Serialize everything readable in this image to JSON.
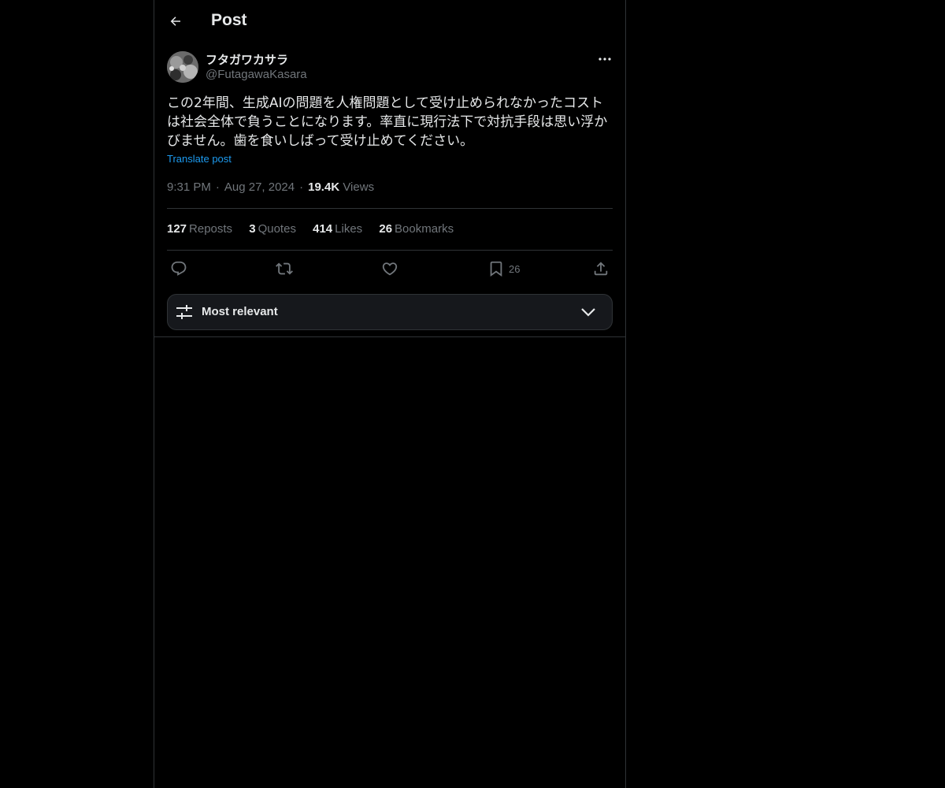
{
  "header": {
    "title": "Post",
    "back_icon": "arrow-left-icon"
  },
  "author": {
    "display_name": "フタガワカサラ",
    "handle": "@FutagawaKasara"
  },
  "post": {
    "text": "この2年間、生成AIの問題を人権問題として受け止められなかったコストは社会全体で負うことになります。率直に現行法下で対抗手段は思い浮かびません。歯を食いしばって受け止めてください。",
    "translate_label": "Translate post",
    "time": "9:31 PM",
    "date": "Aug 27, 2024",
    "separator": "·",
    "views_count": "19.4K",
    "views_label": "Views"
  },
  "stats": {
    "reposts": {
      "count": "127",
      "label": "Reposts"
    },
    "quotes": {
      "count": "3",
      "label": "Quotes"
    },
    "likes": {
      "count": "414",
      "label": "Likes"
    },
    "bookmarks": {
      "count": "26",
      "label": "Bookmarks"
    }
  },
  "actions": {
    "reply_icon": "reply-icon",
    "repost_icon": "repost-icon",
    "like_icon": "heart-icon",
    "bookmark_icon": "bookmark-icon",
    "bookmark_count": "26",
    "share_icon": "share-icon"
  },
  "replies_sort": {
    "label": "Most relevant",
    "icon": "sliders-icon",
    "chevron": "chevron-down-icon"
  },
  "colors": {
    "background": "#000000",
    "text": "#e7e9ea",
    "secondary": "#71767b",
    "accent": "#1d9bf0",
    "border": "#2f3336"
  }
}
